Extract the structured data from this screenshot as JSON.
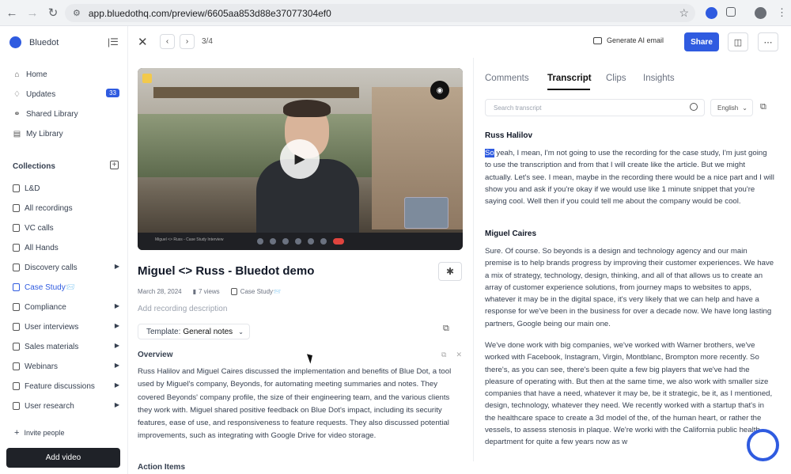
{
  "browser": {
    "url": "app.bluedothq.com/preview/6605aa853d88e37077304ef0"
  },
  "sidebar": {
    "brand": "Bluedot",
    "nav": [
      {
        "label": "Home",
        "icon": "home-icon"
      },
      {
        "label": "Updates",
        "icon": "bell-icon",
        "badge": "33"
      },
      {
        "label": "Shared Library",
        "icon": "shared-icon"
      },
      {
        "label": "My Library",
        "icon": "library-icon"
      }
    ],
    "collections_title": "Collections",
    "collections": [
      {
        "label": "L&D",
        "caret": false
      },
      {
        "label": "All recordings",
        "caret": false
      },
      {
        "label": "VC calls",
        "caret": false
      },
      {
        "label": "All Hands",
        "caret": false
      },
      {
        "label": "Discovery calls",
        "caret": true
      },
      {
        "label": "Case Study📨",
        "caret": false,
        "active": true
      },
      {
        "label": "Compliance",
        "caret": true
      },
      {
        "label": "User interviews",
        "caret": true
      },
      {
        "label": "Sales materials",
        "caret": true
      },
      {
        "label": "Webinars",
        "caret": true
      },
      {
        "label": "Feature discussions",
        "caret": true
      },
      {
        "label": "User research",
        "caret": true
      }
    ],
    "invite": "Invite people",
    "add_video": "Add video"
  },
  "topbar": {
    "counter": "3/4",
    "generate_ai_email": "Generate AI email",
    "share": "Share"
  },
  "meeting": {
    "title": "Miguel <> Russ - Bluedot demo",
    "date": "March 28, 2024",
    "views": "7 views",
    "collection": "Case Study📨",
    "add_description": "Add recording description",
    "template_prefix": "Template:",
    "template_value": "General notes",
    "overview_title": "Overview",
    "overview_text": "Russ Halilov and Miguel Caires discussed the implementation and benefits of Blue Dot, a tool used by Miguel's company, Beyonds, for automating meeting summaries and notes. They covered Beyonds' company profile, the size of their engineering team, and the various clients they work with. Miguel shared positive feedback on Blue Dot's impact, including its security features, ease of use, and responsiveness to feature requests. They also discussed potential improvements, such as integrating with Google Drive for video storage.",
    "action_items_title": "Action Items"
  },
  "video": {
    "meeting_label": "Miguel <> Russ - Case Study Interview"
  },
  "right_panel": {
    "tabs": [
      "Comments",
      "Transcript",
      "Clips",
      "Insights"
    ],
    "active_tab": "Transcript",
    "search_placeholder": "Search transcript",
    "language": "English"
  },
  "transcript": [
    {
      "speaker": "Russ Halilov",
      "highlight": "So",
      "text": " yeah, I mean, I'm not going to use the recording for the case study, I'm just going to use the transcription and from that I will create like the article. But we might actually. Let's see. I mean, maybe in the recording there would be a nice part and I will show you and ask if you're okay if we would use like 1 minute snippet that you're saying cool. Well then if you could tell me about the company would be cool."
    },
    {
      "speaker": "Miguel Caires",
      "text": "Sure. Of course. So beyonds is a design and technology agency and our main premise is to help brands progress by improving their customer experiences. We have a mix of strategy, technology, design, thinking, and all of that allows us to create an array of customer experience solutions, from journey maps to websites to apps, whatever it may be in the digital space, it's very likely that we can help and have a response for we've been in the business for over a decade now. We have long lasting partners, Google being our main one."
    },
    {
      "text": "We've done work with big companies, we've worked with Warner brothers, we've worked with Facebook, Instagram, Virgin, Montblanc, Brompton more recently. So there's, as you can see, there's been quite a few big players that we've had the pleasure of operating with. But then at the same time, we also work with smaller size companies that have a need, whatever it may be, be it strategic, be it, as I mentioned, design, technology, whatever they need. We recently worked with a startup that's in the healthcare space to create a 3d model of the, of the human heart, or rather the vessels, to assess stenosis in plaque. We're worki with the California public health department for quite a few years now as w"
    }
  ],
  "colors": {
    "accent": "#2f5be0",
    "dark_button": "#1f2228"
  }
}
